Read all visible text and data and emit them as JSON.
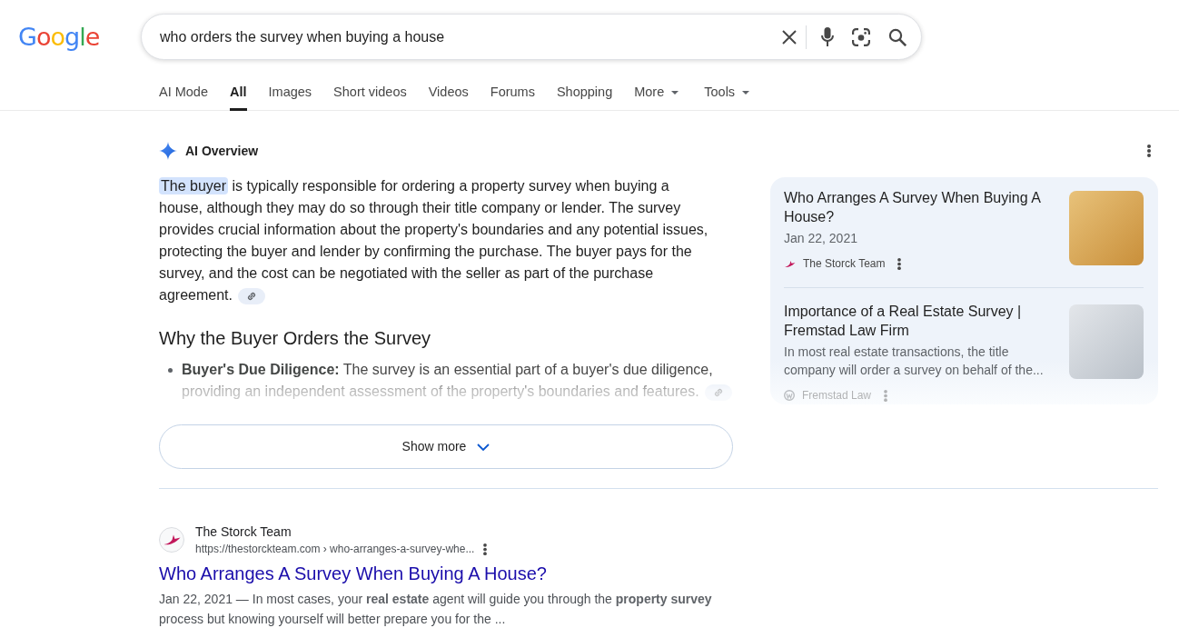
{
  "header": {
    "logo": "Google",
    "search": {
      "value": "who orders the survey when buying a house"
    }
  },
  "tabs": [
    {
      "label": "AI Mode",
      "selected": false,
      "dropdown": false
    },
    {
      "label": "All",
      "selected": true,
      "dropdown": false
    },
    {
      "label": "Images",
      "selected": false,
      "dropdown": false
    },
    {
      "label": "Short videos",
      "selected": false,
      "dropdown": false
    },
    {
      "label": "Videos",
      "selected": false,
      "dropdown": false
    },
    {
      "label": "Forums",
      "selected": false,
      "dropdown": false
    },
    {
      "label": "Shopping",
      "selected": false,
      "dropdown": false
    },
    {
      "label": "More",
      "selected": false,
      "dropdown": true
    },
    {
      "label": "Tools",
      "selected": false,
      "dropdown": true
    }
  ],
  "ai_overview": {
    "title": "AI Overview",
    "answer": {
      "highlight": "The buyer",
      "text": "is typically responsible for ordering a property survey when buying a house, although they may do so through their title company or lender. The survey provides crucial information about the property's boundaries and any potential issues, protecting the buyer and lender by confirming the purchase. The buyer pays for the survey, and the cost can be negotiated with the seller as part of the purchase agreement.",
      "citation": true
    },
    "heading": "Why the Buyer Orders the Survey",
    "bullets": [
      {
        "text": "**Buyer's Due Diligence:** The survey is an essential part of a buyer's due diligence, providing an independent assessment of the property's boundaries and features.",
        "citation": true
      }
    ],
    "show_more": "Show more",
    "sources": [
      {
        "kind": "bird",
        "title": "Who Arranges A Survey When Buying A House?",
        "date": "Jan 22, 2021",
        "site": "The Storck Team"
      },
      {
        "kind": "disc",
        "title": "Importance of a Real Estate Survey | Fremstad Law Firm",
        "snippet": "In most real estate transactions, the title company will order a survey on behalf of the...",
        "site": "Fremstad Law"
      }
    ]
  },
  "results": [
    {
      "site": "The Storck Team",
      "url": "https://thestorckteam.com › who-arranges-a-survey-whe...",
      "title": "Who Arranges A Survey When Buying A House?",
      "snippet": "Jan 22, 2021 — In most cases, your **real estate** agent will guide you through the **property survey** process but knowing yourself will better prepare you for the ..."
    }
  ]
}
